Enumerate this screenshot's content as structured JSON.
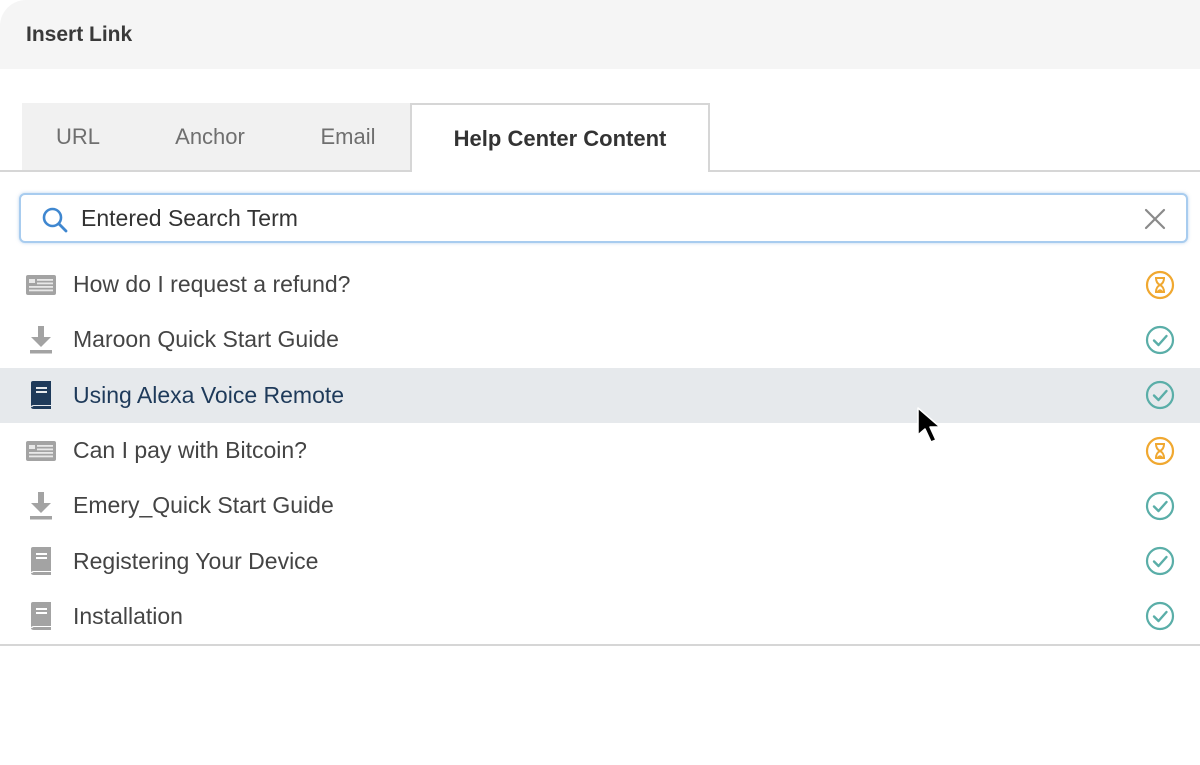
{
  "dialog": {
    "title": "Insert Link"
  },
  "tabs": [
    {
      "label": "URL",
      "active": false
    },
    {
      "label": "Anchor",
      "active": false
    },
    {
      "label": "Email",
      "active": false
    },
    {
      "label": "Help Center Content",
      "active": true
    }
  ],
  "search": {
    "value": "Entered Search Term",
    "icon": "search-icon",
    "clear_icon": "close-icon"
  },
  "results": [
    {
      "label": "How do I request a refund?",
      "type_icon": "article-icon",
      "status_icon": "hourglass-icon",
      "status": "pending"
    },
    {
      "label": "Maroon Quick Start Guide",
      "type_icon": "download-icon",
      "status_icon": "check-circle-icon",
      "status": "published"
    },
    {
      "label": "Using Alexa Voice Remote",
      "type_icon": "book-icon",
      "status_icon": "check-circle-icon",
      "status": "published",
      "highlighted": true
    },
    {
      "label": "Can I pay with Bitcoin?",
      "type_icon": "article-icon",
      "status_icon": "hourglass-icon",
      "status": "pending"
    },
    {
      "label": "Emery_Quick Start Guide",
      "type_icon": "download-icon",
      "status_icon": "check-circle-icon",
      "status": "published"
    },
    {
      "label": "Registering Your Device",
      "type_icon": "book-icon",
      "status_icon": "check-circle-icon",
      "status": "published"
    },
    {
      "label": "Installation",
      "type_icon": "book-icon",
      "status_icon": "check-circle-icon",
      "status": "published"
    }
  ],
  "colors": {
    "pending": "#f0a830",
    "published": "#5aaea8",
    "highlight_bg": "#e6e9ec",
    "highlight_text": "#1e3a5a",
    "search_icon": "#3f87d0",
    "icon_gray": "#9a9a9a",
    "book_dark": "#1e3a5a"
  }
}
